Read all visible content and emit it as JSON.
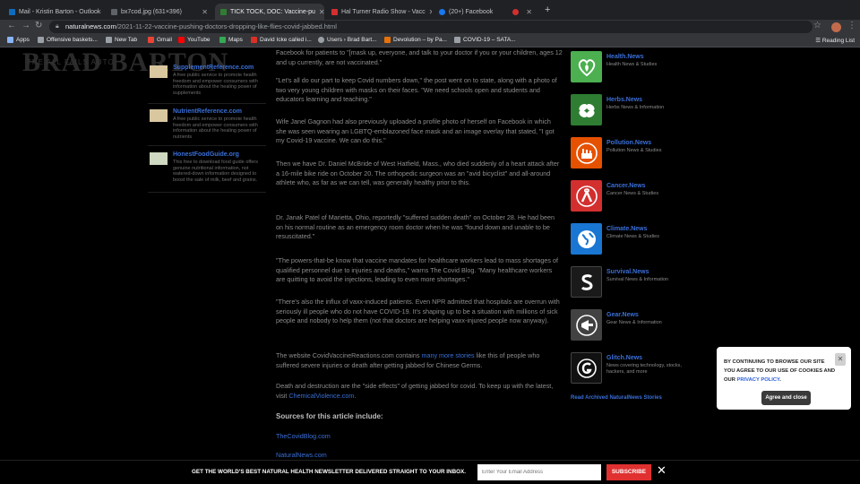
{
  "tabs": [
    {
      "label": "Mail - Kristin Barton - Outlook",
      "color": "#0f6cbd",
      "active": false
    },
    {
      "label": "bx7cod.jpg (631×396)",
      "color": "#5f6368",
      "active": false
    },
    {
      "label": "TICK TOCK, DOC: Vaccine-pu",
      "color": "#2e7d32",
      "active": true
    },
    {
      "label": "Hal Turner Radio Show - Vacc",
      "color": "#d32f2f",
      "active": false
    },
    {
      "label": "(20+) Facebook",
      "color": "#1877f2",
      "active": false
    }
  ],
  "url": {
    "host": "naturalnews.com",
    "path": "/2021-11-22-vaccine-pushing-doctors-dropping-like-flies-covid-jabbed.html"
  },
  "bookmarks": [
    {
      "label": "Apps",
      "color": "#8ab4f8"
    },
    {
      "label": "Offensive baskets...",
      "color": "#9aa0a6"
    },
    {
      "label": "New Tab",
      "color": "#9aa0a6"
    },
    {
      "label": "Gmail",
      "color": "#ea4335"
    },
    {
      "label": "YouTube",
      "color": "#ff0000"
    },
    {
      "label": "Maps",
      "color": "#34a853"
    },
    {
      "label": "David Icke called i...",
      "color": "#d93025"
    },
    {
      "label": "Users › Brad Bart...",
      "color": "#9aa0a6"
    },
    {
      "label": "Devolution – by Pa...",
      "color": "#e8710a"
    },
    {
      "label": "COVID-19 – SATA...",
      "color": "#9aa0a6"
    }
  ],
  "reading_list": "Reading List",
  "watermark": "BRAD BARTON",
  "watermark_sub": "THE ALL FAILS AUTO",
  "left_sponsors": [
    {
      "title": "SupplementReference.com",
      "desc": "A free public service to promote health freedom and empower consumers with information about the healing power of supplements"
    },
    {
      "title": "NutrientReference.com",
      "desc": "A free public service to promote health freedom and empower consumers with information about the healing power of nutrients"
    },
    {
      "title": "HonestFoodGuide.org",
      "desc": "This free to download food guide offers genuine nutritional information, not watered-down information designed to boost the sale of milk, beef and grains."
    }
  ],
  "article": {
    "p0": "Facebook for patients to \"[mask up, everyone, and talk to your doctor if you or your children, ages 12 and up currently, are not vaccinated.\"",
    "p1": "\"Let's all do our part to keep Covid numbers down,\" the post went on to state, along with a photo of two very young children with masks on their faces. \"We need schools open and students and educators learning and teaching.\"",
    "p2": "Wife Janel Gagnon had also previously uploaded a profile photo of herself on Facebook in which she was seen wearing an LGBTQ-emblazoned face mask and an image overlay that stated, \"I got my Covid-19 vaccine. We can do this.\"",
    "p3": "Then we have Dr. Daniel McBride of West Hatfield, Mass., who died suddenly of a heart attack after a 16-mile bike ride on October 20. The orthopedic surgeon was an \"avid bicyclist\" and all-around athlete who, as far as we can tell, was generally healthy prior to this.",
    "p4": "Dr. Janak Patel of Marietta, Ohio, reportedly \"suffered sudden death\" on October 28. He had been on his normal routine as an emergency room doctor when he was \"found down and unable to be resuscitated.\"",
    "p5": "\"The powers-that-be know that vaccine mandates for healthcare workers lead to mass shortages of qualified personnel due to injuries and deaths,\" warns The Covid Blog. \"Many healthcare workers are quitting to avoid the injections, leading to even more shortages.\"",
    "p6": "\"There's also the influx of vaxx-induced patients. Even NPR admitted that hospitals are overrun with seriously ill people who do not have COVID-19. It's shaping up to be a situation with millions of sick people and nobody to help them (not that doctors are helping vaxx-injured people now anyway).",
    "p7a": "The website CovidVaccineReactions.com contains ",
    "p7link": "many more stories",
    "p7b": " like this of people who suffered severe injuries or death after getting jabbed for Chinese Germs.",
    "p8a": "Death and destruction are the \"side effects\" of getting jabbed for covid. To keep up with the latest, visit ",
    "p8link": "ChemicalViolence.com",
    "p8b": ".",
    "sources_heading": "Sources for this article include:",
    "source1": "TheCovidBlog.com",
    "source2": "NaturalNews.com"
  },
  "right_sites": [
    {
      "title": "Health.News",
      "desc": "Health News & Studies",
      "bg": "#4caf50",
      "icon": "heart-leaf-icon"
    },
    {
      "title": "Herbs.News",
      "desc": "Herbs News & Information",
      "bg": "#2e7d32",
      "icon": "leaves-icon"
    },
    {
      "title": "Pollution.News",
      "desc": "Pollution News & Studies",
      "bg": "#e65100",
      "icon": "factory-icon"
    },
    {
      "title": "Cancer.News",
      "desc": "Cancer News & Studies",
      "bg": "#d32f2f",
      "icon": "ribbon-icon"
    },
    {
      "title": "Climate.News",
      "desc": "Climate News & Studies",
      "bg": "#1976d2",
      "icon": "globe-icon"
    },
    {
      "title": "Survival.News",
      "desc": "Survival News & Information",
      "bg": "#1a1a1a",
      "icon": "s-letter-icon"
    },
    {
      "title": "Gear.News",
      "desc": "Gear News & Information",
      "bg": "#424242",
      "icon": "megaphone-icon"
    },
    {
      "title": "Glitch.News",
      "desc": "News covering technology, stocks, hackers, and more",
      "bg": "#111111",
      "icon": "g-letter-icon"
    }
  ],
  "archived_link": "Read Archived NaturalNews Stories",
  "cookie": {
    "text1": "BY CONTINUING TO BROWSE OUR SITE YOU AGREE TO OUR USE OF COOKIES AND OUR ",
    "link": "PRIVACY POLICY",
    "text2": ".",
    "button": "Agree and close"
  },
  "newsletter": {
    "text": "GET THE WORLD'S BEST NATURAL HEALTH NEWSLETTER DELIVERED STRAIGHT TO YOUR INBOX.",
    "placeholder": "Enter Your Email Address",
    "button": "SUBSCRIBE"
  }
}
